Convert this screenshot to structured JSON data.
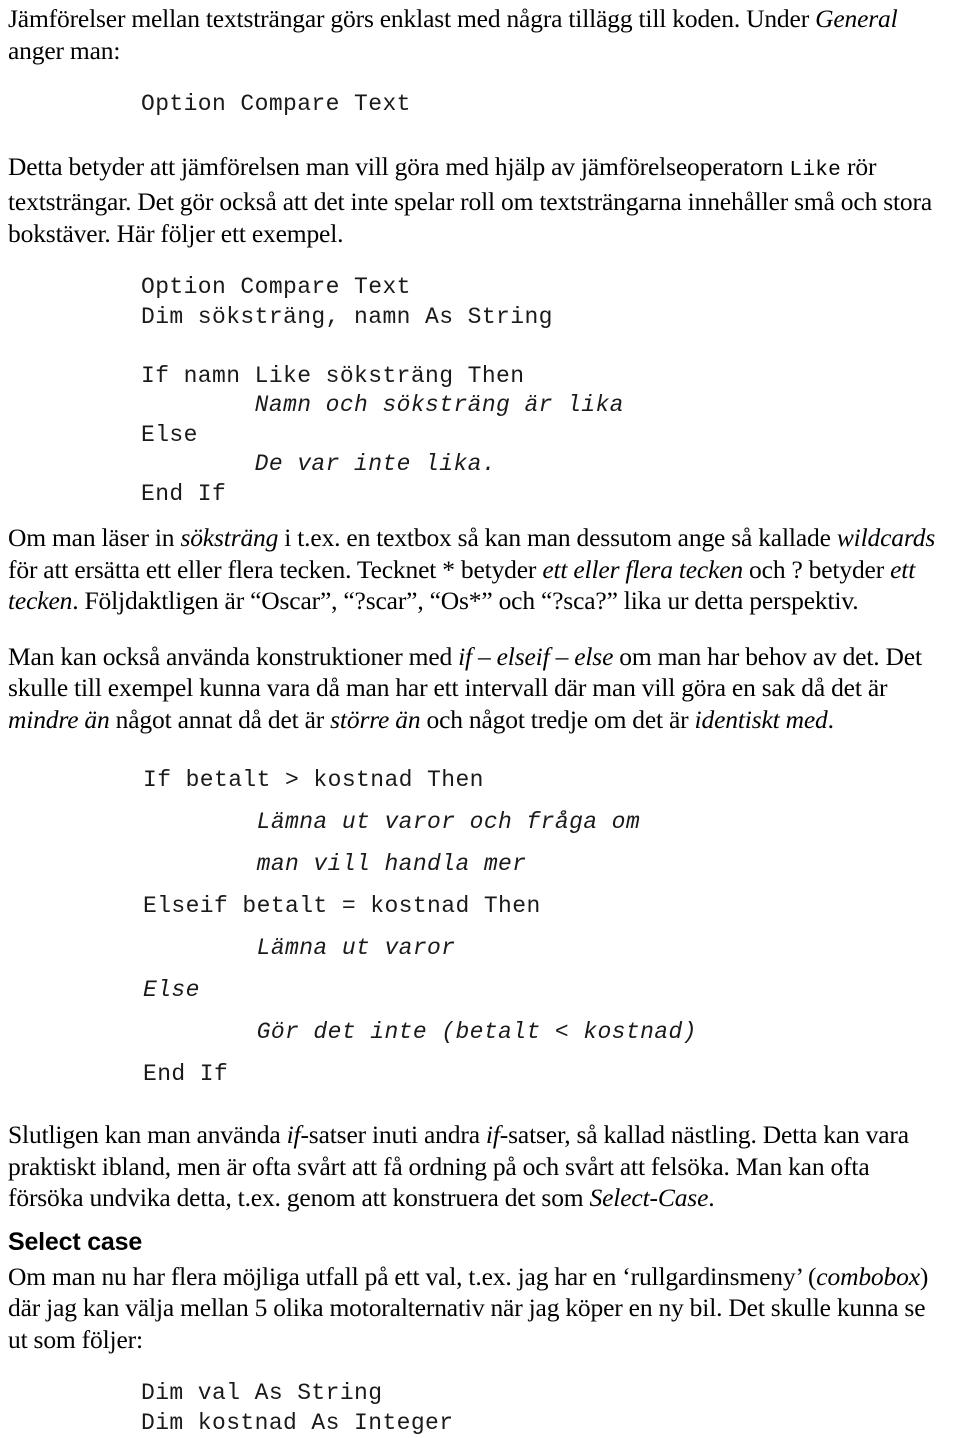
{
  "document": {
    "language": "sv",
    "text_color": "#000000",
    "background_color": "#ffffff"
  },
  "paragraphs": {
    "intro_1": "Jämförelser mellan textsträngar görs enklast med några tillägg till koden. Under ",
    "intro_1_italic": "General",
    "intro_2": "anger man:",
    "explain_1a": "Detta betyder att jämförelsen man vill göra med hjälp av jämförelseoperatorn ",
    "explain_1_mono": "Like",
    "explain_1b": " rör textsträngar. Det gör också att det inte spelar roll om textsträngarna innehåller små och stora bokstäver. Här följer ett exempel.",
    "wildcards_a": "Om man läser in ",
    "wildcards_i1": "söksträng",
    "wildcards_b": " i t.ex. en textbox så kan man dessutom ange så kallade ",
    "wildcards_i2": "wildcards",
    "wildcards_c": " för att ersätta ett eller flera tecken. Tecknet * betyder ",
    "wildcards_i3": "ett eller flera tecken",
    "wildcards_d": " och ? betyder ",
    "wildcards_i4": "ett tecken",
    "wildcards_e": ". Följdaktligen är “Oscar”, “?scar”, “Os*” och “?sca?” lika ur detta perspektiv.",
    "ifelse_a": "Man kan också använda konstruktioner med ",
    "ifelse_i1": "if – elseif – else",
    "ifelse_b": " om man har behov av det. Det skulle till exempel kunna vara då man har ett intervall där man vill göra en sak då det är ",
    "ifelse_i2": "mindre än",
    "ifelse_c": " något annat då det är ",
    "ifelse_i3": "större än",
    "ifelse_d": " och något tredje om det är ",
    "ifelse_i4": "identiskt med",
    "ifelse_e": ".",
    "nesting_a": "Slutligen kan man använda ",
    "nesting_i1": "if",
    "nesting_b": "-satser inuti andra ",
    "nesting_i2": "if",
    "nesting_c": "-satser, så kallad nästling. Detta kan vara praktiskt ibland, men är ofta svårt att få ordning på och svårt att felsöka. Man kan ofta försöka undvika detta, t.ex. genom att konstruera det som ",
    "nesting_i3": "Select-Case",
    "nesting_d": ".",
    "selectcase_a": "Om man nu har flera möjliga utfall på ett val, t.ex. jag har en ‘rullgardinsmeny’ (",
    "selectcase_i1": "combobox",
    "selectcase_b": ") där jag kan välja mellan 5 olika motoralternativ när jag köper en ny bil. Det skulle kunna se ut som följer:"
  },
  "headings": {
    "select_case": "Select case"
  },
  "code_snippet_inline": {
    "option_compare_text": "Option Compare Text"
  },
  "code_block_1": {
    "lines": [
      {
        "text": "Option Compare Text",
        "italic": false
      },
      {
        "text": "Dim söksträng, namn As String",
        "italic": false
      },
      {
        "text": "",
        "italic": false
      },
      {
        "text": "If namn Like söksträng Then",
        "italic": false
      },
      {
        "text": "        Namn och söksträng är lika",
        "italic": true
      },
      {
        "text": "Else",
        "italic": false
      },
      {
        "text": "        De var inte lika.",
        "italic": true
      },
      {
        "text": "End If",
        "italic": false
      }
    ]
  },
  "code_block_2": {
    "lines": [
      {
        "text": "If betalt > kostnad Then",
        "italic": false
      },
      {
        "text": "        Lämna ut varor och fråga om",
        "italic": true
      },
      {
        "text": "        man vill handla mer",
        "italic": true
      },
      {
        "text": "Elseif betalt = kostnad Then",
        "italic": false
      },
      {
        "text": "        Lämna ut varor",
        "italic": true
      },
      {
        "text": "Else",
        "italic": true
      },
      {
        "text": "        Gör det inte (betalt < kostnad)",
        "italic": true
      },
      {
        "text": "End If",
        "italic": false
      }
    ]
  },
  "code_block_3": {
    "lines": [
      {
        "text": "Dim val As String",
        "italic": false
      },
      {
        "text": "Dim kostnad As Integer",
        "italic": false
      }
    ]
  }
}
